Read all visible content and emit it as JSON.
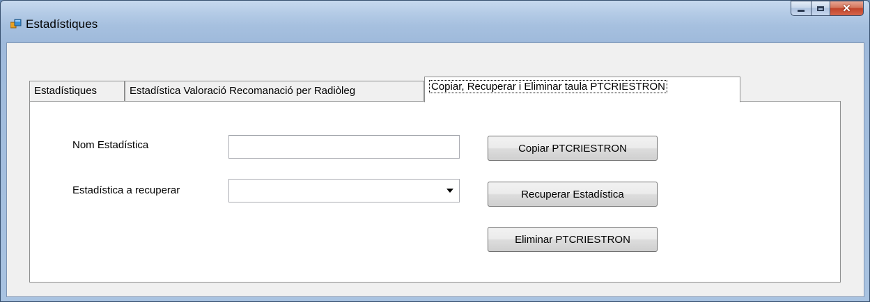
{
  "window": {
    "title": "Estadístiques",
    "controls": {
      "minimize": "minimize-icon",
      "maximize": "maximize-icon",
      "close": "close-icon"
    }
  },
  "tabs": [
    {
      "label": "Estadístiques"
    },
    {
      "label": "Estadística Valoració Recomanació per Radiòleg"
    },
    {
      "label": "Copiar, Recuperar i Eliminar taula PTCRIESTRON"
    }
  ],
  "form": {
    "nom_label": "Nom Estadística",
    "nom_value": "",
    "recuperar_label": "Estadística a recuperar",
    "recuperar_value": ""
  },
  "buttons": {
    "copy": "Copiar PTCRIESTRON",
    "recover": "Recuperar Estadística",
    "delete": "Eliminar PTCRIESTRON"
  },
  "colors": {
    "accent": "#6d8fb8",
    "close": "#c0432a"
  }
}
